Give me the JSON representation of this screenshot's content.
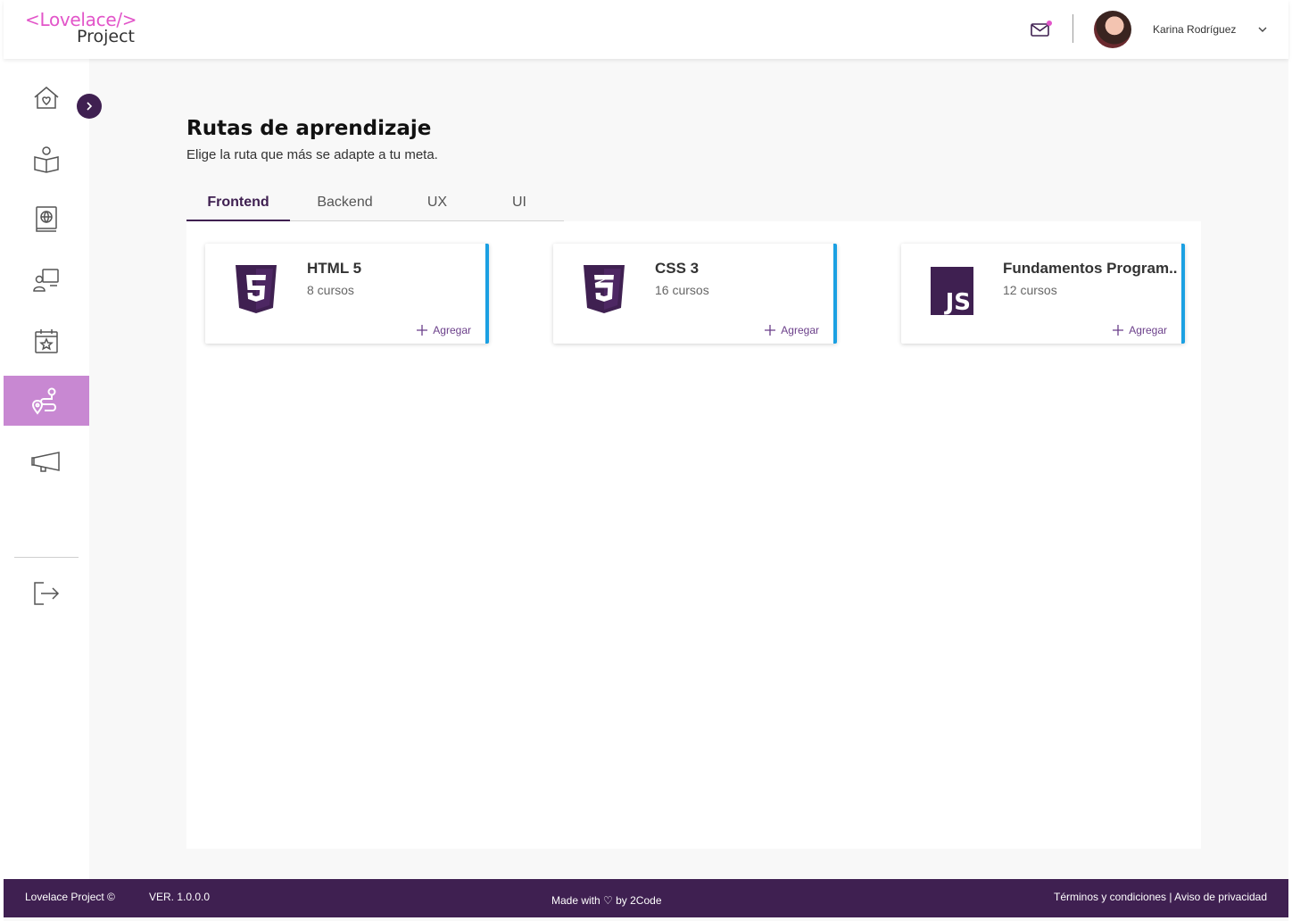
{
  "header": {
    "logo_line1": "<Lovelace/>",
    "logo_line2": "Project",
    "user_name": "Karina Rodríguez",
    "accent": "#e255c9"
  },
  "sidebar": {
    "items": [
      {
        "icon": "home-heart-icon"
      },
      {
        "icon": "reader-book-icon"
      },
      {
        "icon": "globe-book-icon"
      },
      {
        "icon": "mentor-board-icon"
      },
      {
        "icon": "calendar-star-icon"
      },
      {
        "icon": "route-pin-icon",
        "active": true
      },
      {
        "icon": "megaphone-icon"
      },
      {
        "icon": "logout-icon"
      }
    ],
    "active_color": "#c888d2"
  },
  "main": {
    "title": "Rutas de aprendizaje",
    "subtitle": "Elige la ruta que más se adapte a tu meta.",
    "tabs": [
      {
        "label": "Frontend",
        "active": true
      },
      {
        "label": "Backend"
      },
      {
        "label": "UX"
      },
      {
        "label": "UI"
      }
    ],
    "cards": [
      {
        "title": "HTML 5",
        "count": "8 cursos",
        "action": "Agregar",
        "icon": "html5-icon"
      },
      {
        "title": "CSS 3",
        "count": "16 cursos",
        "action": "Agregar",
        "icon": "css3-icon"
      },
      {
        "title": "Fundamentos Program..",
        "count": "12 cursos",
        "action": "Agregar",
        "icon": "javascript-icon"
      }
    ]
  },
  "footer": {
    "brand": "Lovelace Project ©",
    "version": "VER. 1.0.0.0",
    "made_with": "Made with ♡ by 2Code",
    "links": "Términos y condiciones | Aviso de privacidad",
    "bg": "#3f2051"
  }
}
